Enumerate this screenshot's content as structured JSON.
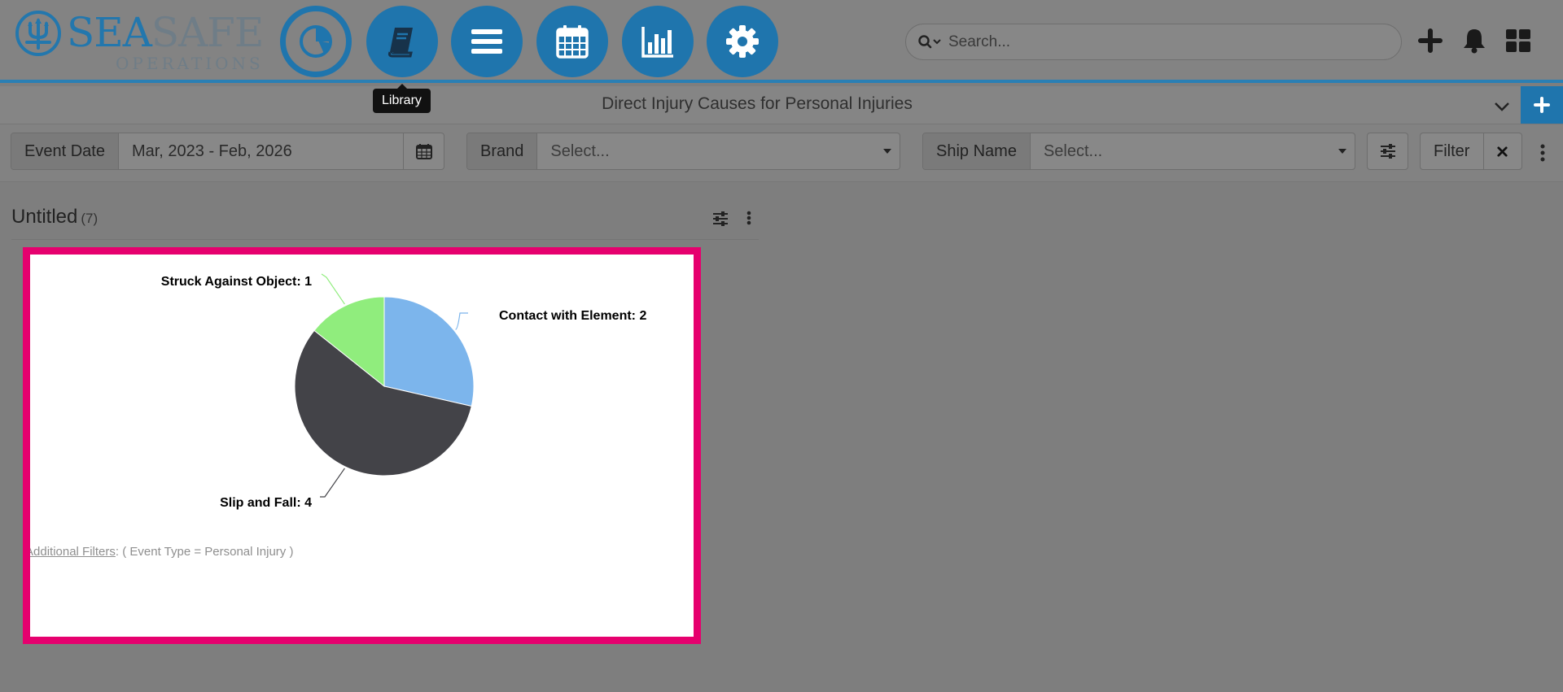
{
  "brand": {
    "name_part1": "SEA",
    "name_part2": "SAFE",
    "subtitle": "OPERATIONS"
  },
  "nav": [
    {
      "id": "dashboard",
      "icon": "pie-chart-icon",
      "active": true
    },
    {
      "id": "library",
      "icon": "book-icon",
      "active": false
    },
    {
      "id": "menu",
      "icon": "list-icon",
      "active": false
    },
    {
      "id": "calendar",
      "icon": "calendar-icon",
      "active": false
    },
    {
      "id": "reports",
      "icon": "bar-chart-icon",
      "active": false
    },
    {
      "id": "settings",
      "icon": "gear-icon",
      "active": false
    }
  ],
  "tooltip": {
    "text": "Library"
  },
  "search": {
    "placeholder": "Search..."
  },
  "header_icons": [
    "plus-icon",
    "bell-icon",
    "grid-icon"
  ],
  "titlebar": {
    "title": "Direct Injury Causes for Personal Injuries"
  },
  "filters": {
    "event_date": {
      "label": "Event Date",
      "value": "Mar, 2023 - Feb, 2026"
    },
    "brand": {
      "label": "Brand",
      "placeholder": "Select..."
    },
    "ship_name": {
      "label": "Ship Name",
      "placeholder": "Select..."
    },
    "filter_button": "Filter"
  },
  "section": {
    "title": "Untitled",
    "count": "(7)"
  },
  "widget": {
    "additional_filters_label": "Additional Filters",
    "additional_filters_value": ": ( Event Type = Personal Injury )"
  },
  "colors": {
    "accent": "#1f75ad",
    "highlight_border": "#e6006e"
  },
  "chart_data": {
    "type": "pie",
    "title": "",
    "slices": [
      {
        "label": "Contact with Element",
        "value": 2,
        "color": "#7cb5ec",
        "display": "Contact with Element: 2"
      },
      {
        "label": "Slip and Fall",
        "value": 4,
        "color": "#434348",
        "display": "Slip and Fall: 4"
      },
      {
        "label": "Struck Against Object",
        "value": 1,
        "color": "#90ed7d",
        "display": "Struck Against Object: 1"
      }
    ]
  }
}
